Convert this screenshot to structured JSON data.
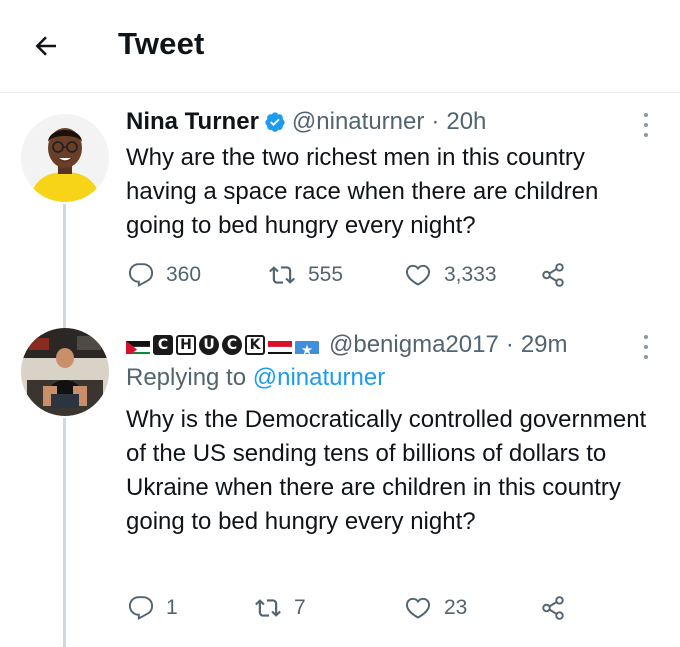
{
  "header": {
    "title": "Tweet",
    "back_icon": "arrow-left-icon"
  },
  "tweets": [
    {
      "display_name": "Nina Turner",
      "verified": true,
      "handle": "@ninaturner",
      "separator": "·",
      "time": "20h",
      "text": "Why are the two richest men in this country having a space race when there are children going to bed hungry every night?",
      "replies": "360",
      "retweets": "555",
      "likes": "3,333"
    },
    {
      "display_name_letters": [
        "C",
        "H",
        "U",
        "C",
        "K"
      ],
      "handle": "@benigma2017",
      "separator": "·",
      "time": "29m",
      "reply_prefix": "Replying to",
      "reply_to": "@ninaturner",
      "text": "Why is the Democratically controlled government of the US sending tens of billions of dollars to Ukraine when there are children in this country going to bed hungry every night?",
      "replies": "1",
      "retweets": "7",
      "likes": "23"
    }
  ],
  "colors": {
    "accent": "#1d9bf0",
    "secondary_text": "#536471",
    "border": "#e6ecf0"
  }
}
